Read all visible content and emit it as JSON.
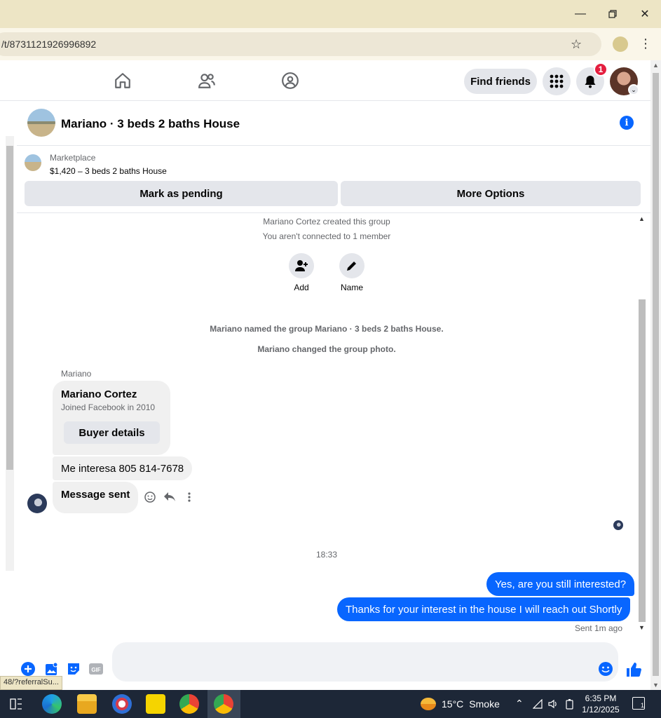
{
  "browser": {
    "url": "/t/8731121926996892",
    "status_url": "48/?referralSu..."
  },
  "nav": {
    "find_friends": "Find friends",
    "notification_count": "1"
  },
  "chat": {
    "title": "Mariano · 3 beds 2 baths House",
    "marketplace_label": "Marketplace",
    "listing": "$1,420 – 3 beds 2 baths House",
    "mark_pending": "Mark as pending",
    "more_options": "More Options"
  },
  "messages": {
    "created": "Mariano Cortez created this group",
    "not_connected": "You aren't connected to 1 member",
    "add_label": "Add",
    "name_label": "Name",
    "event_named": "Mariano named the group Mariano · 3 beds 2 baths House.",
    "event_photo": "Mariano changed the group photo.",
    "sender": "Mariano",
    "card_name": "Mariano Cortez",
    "card_sub": "Joined Facebook in 2010",
    "card_button": "Buyer details",
    "msg1": "Me interesa 805 814-7678",
    "msg2": "Message sent",
    "time": "18:33",
    "out1": "Yes, are you still interested?",
    "out2": "Thanks for your interest in the house I will reach out Shortly",
    "sent_status": "Sent 1m ago"
  },
  "taskbar": {
    "weather_temp": "15°C",
    "weather_desc": "Smoke",
    "time": "6:35 PM",
    "date": "1/12/2025",
    "notif_count": "1"
  },
  "colors": {
    "accent": "#0866ff",
    "bubble_in": "#f0f0f0",
    "titlebar": "#ede5c5"
  }
}
